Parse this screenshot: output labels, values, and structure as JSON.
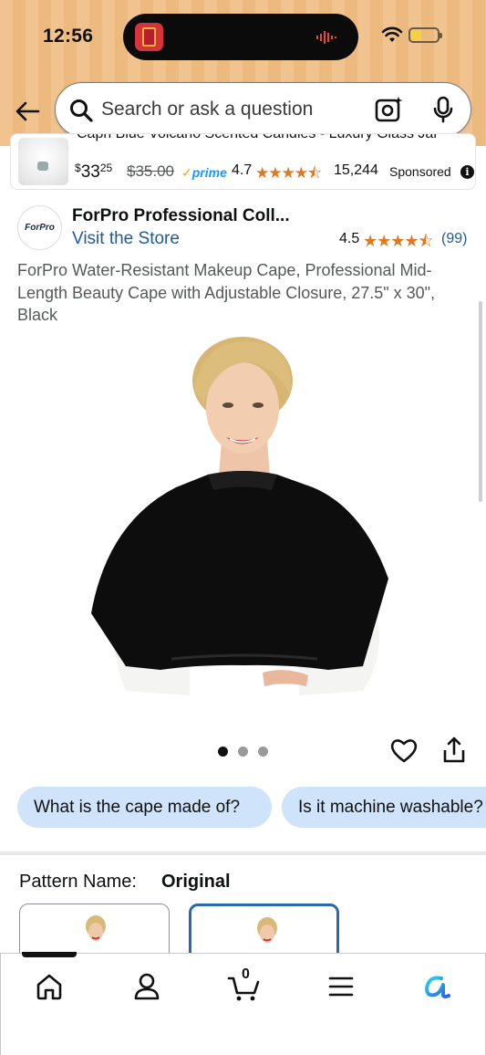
{
  "status_bar": {
    "time": "12:56"
  },
  "search": {
    "placeholder": "Search or ask a question"
  },
  "sponsored": {
    "title": "Capri Blue Volcano Scented Candles - Luxury Glass Jar",
    "price_symbol": "$",
    "price_whole": "33",
    "price_cents": "25",
    "list_price": "$35.00",
    "prime": "prime",
    "rating": "4.7",
    "stars": "★★★★⯪",
    "review_count": "15,244",
    "label": "Sponsored"
  },
  "store": {
    "logo_text": "ForPro",
    "name": "ForPro Professional Coll...",
    "link": "Visit the Store",
    "rating": "4.5",
    "stars": "★★★★⯪",
    "review_count": "(99)"
  },
  "product": {
    "title": "ForPro Water-Resistant Makeup Cape, Professional Mid-Length Beauty Cape with Adjustable Closure, 27.5\" x 30\", Black",
    "image_count": 3,
    "active_image_index": 0
  },
  "chips": [
    "What is the cape made of?",
    "Is it machine washable?"
  ],
  "pattern": {
    "label": "Pattern Name:",
    "value": "Original"
  },
  "bottom_nav": {
    "items": [
      "home-icon",
      "account-icon",
      "cart-icon",
      "menu-icon",
      "rufus-icon"
    ],
    "cart_count": "0",
    "active_index": 0
  },
  "colors": {
    "header": "#f1c48f",
    "link": "#1f5c91",
    "star": "#de7921",
    "chip": "#cfe4fa",
    "selected_border": "#2a6aa8"
  }
}
